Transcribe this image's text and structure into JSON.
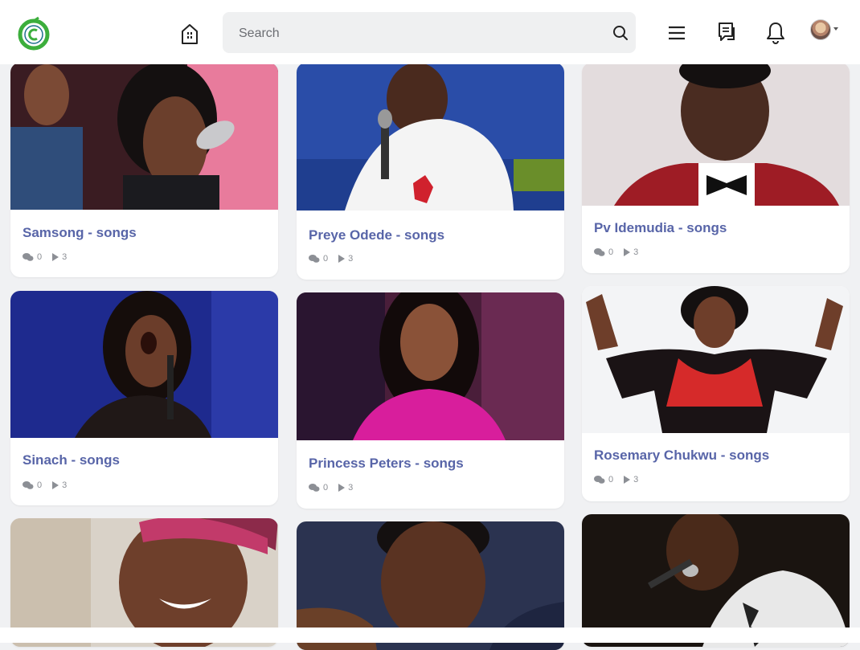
{
  "header": {
    "search_placeholder": "Search"
  },
  "cards": [
    {
      "title": "Samsong - songs",
      "comments": "0",
      "plays": "3"
    },
    {
      "title": "Preye Odede - songs",
      "comments": "0",
      "plays": "3"
    },
    {
      "title": "Pv Idemudia - songs",
      "comments": "0",
      "plays": "3"
    },
    {
      "title": "Sinach - songs",
      "comments": "0",
      "plays": "3"
    },
    {
      "title": "Princess Peters - songs",
      "comments": "0",
      "plays": "3"
    },
    {
      "title": "Rosemary Chukwu - songs",
      "comments": "0",
      "plays": "3"
    },
    {
      "title": "",
      "comments": "",
      "plays": ""
    },
    {
      "title": "",
      "comments": "",
      "plays": ""
    },
    {
      "title": "",
      "comments": "",
      "plays": ""
    }
  ],
  "colors": {
    "accent": "#5865a8",
    "logo_green": "#3cae3c",
    "background": "#f0f1f3"
  },
  "icons": [
    "logo-icon",
    "home-icon",
    "search-icon",
    "menu-icon",
    "messages-icon",
    "bell-icon",
    "comments-icon",
    "play-icon",
    "chevron-down-icon"
  ]
}
